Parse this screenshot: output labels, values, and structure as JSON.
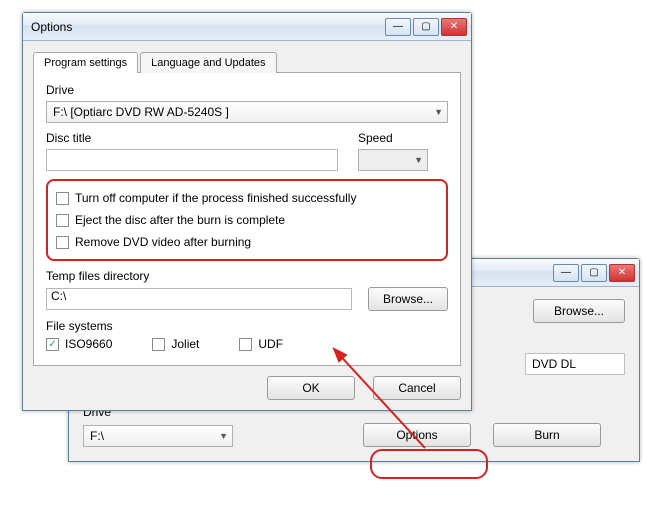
{
  "bg": {
    "win_btns": {
      "min": "—",
      "max": "▢",
      "close": "✕"
    },
    "browse_label": "Browse...",
    "dvd_text": "DVD DL",
    "drive_label": "Drive",
    "drive_value": "F:\\",
    "options_btn": "Options",
    "burn_btn": "Burn"
  },
  "fg": {
    "title": "Options",
    "win_btns": {
      "min": "—",
      "max": "▢",
      "close": "✕"
    },
    "tabs": {
      "program": "Program settings",
      "lang": "Language and Updates"
    },
    "drive_label": "Drive",
    "drive_value": "F:\\ [Optiarc DVD RW AD-5240S ]",
    "disc_title_label": "Disc title",
    "disc_title_value": "",
    "speed_label": "Speed",
    "speed_value": "",
    "checks": {
      "c1": "Turn off computer if the process finished successfully",
      "c2": "Eject the disc after the burn is complete",
      "c3": "Remove DVD video after burning"
    },
    "temp_label": "Temp files directory",
    "temp_value": "C:\\",
    "browse_label": "Browse...",
    "fs_label": "File systems",
    "fs": {
      "iso": "ISO9660",
      "joliet": "Joliet",
      "udf": "UDF"
    },
    "ok": "OK",
    "cancel": "Cancel",
    "check_mark": "✓"
  }
}
